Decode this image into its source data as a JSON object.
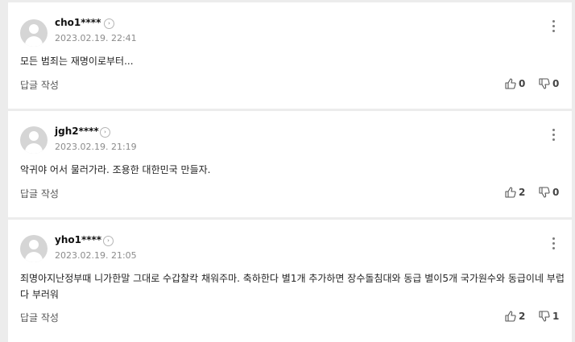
{
  "comments": [
    {
      "username": "cho1****",
      "timestamp": "2023.02.19. 22:41",
      "text": "모든 범죄는 재명이로부터...",
      "reply_label": "답글 작성",
      "likes": "0",
      "dislikes": "0"
    },
    {
      "username": "jgh2****",
      "timestamp": "2023.02.19. 21:19",
      "text": "악귀야 어서 물러가라. 조용한 대한민국 만들자.",
      "reply_label": "답글 작성",
      "likes": "2",
      "dislikes": "0"
    },
    {
      "username": "yho1****",
      "timestamp": "2023.02.19. 21:05",
      "text": "죄명아지난정부때 니가한말 그대로 수갑찰칵 채워주마. 축하한다 별1개 추가하면 장수돌침대와 동급 별이5개 국가원수와 동급이네 부럽다 부러워",
      "reply_label": "답글 작성",
      "likes": "2",
      "dislikes": "1"
    }
  ],
  "icons": {
    "profile_arrow": "chevron-right-icon",
    "more": "more-vertical-icon",
    "like": "thumbs-up-icon",
    "dislike": "thumbs-down-icon"
  }
}
